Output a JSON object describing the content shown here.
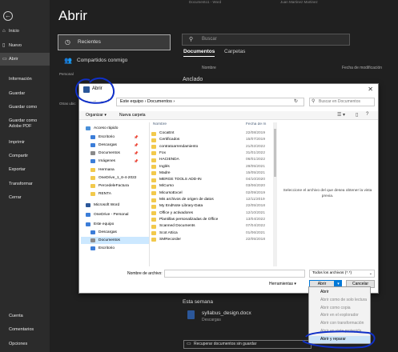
{
  "topbar": {
    "left": "Documento1  -  Word",
    "right": "Juan Martinez Martinez"
  },
  "sidebar": {
    "back": "←",
    "items": [
      {
        "label": "Inicio",
        "icon": "⌂"
      },
      {
        "label": "Nuevo",
        "icon": "▯"
      },
      {
        "label": "Abrir",
        "icon": "▭"
      }
    ],
    "plain": [
      "Información",
      "Guardar",
      "Guardar como",
      "Guardar como Adobe PDF",
      "Imprimir",
      "Compartir",
      "Exportar",
      "Transformar",
      "Cerrar"
    ],
    "bottom": [
      "Cuenta",
      "Comentarios",
      "Opciones"
    ]
  },
  "main": {
    "title": "Abrir",
    "locations": [
      {
        "label": "Recientes",
        "icon": "◷"
      },
      {
        "label": "Compartidos conmigo",
        "icon": "👥"
      }
    ],
    "personal_label": "Personal",
    "other_label": "Otras ubic",
    "search_placeholder": "Buscar",
    "tabs": [
      "Documentos",
      "Carpetas"
    ],
    "col_name": "Nombre",
    "col_date": "Fecha de modificación",
    "pinned": "Anclado",
    "this_week": "Esta semana",
    "recent_file": {
      "name": "syllabus_design.docx",
      "location": "Descargas"
    },
    "recover_button": "Recuperar documentos sin guardar"
  },
  "dialog": {
    "title": "Abrir",
    "path": "Este equipo  ›  Documentos  ›",
    "search_placeholder": "Buscar en Documentos",
    "organize": "Organizar ▾",
    "new_folder": "Nueva carpeta",
    "col_name": "Nombre",
    "col_date": "Fecha de m",
    "nav_items": [
      {
        "label": "Acceso rápido",
        "color": "#4a90d9",
        "pin": ""
      },
      {
        "label": "Escritorio",
        "color": "#3b7dd8",
        "pin": "📌"
      },
      {
        "label": "Descargas",
        "color": "#3b7dd8",
        "pin": "📌"
      },
      {
        "label": "Documentos",
        "color": "#8a8a8a",
        "pin": "📌"
      },
      {
        "label": "Imágenes",
        "color": "#3b7dd8",
        "pin": "📌"
      },
      {
        "label": "Hermana",
        "color": "#f2c94c",
        "pin": ""
      },
      {
        "label": "OneDrive_1_6-4-2022",
        "color": "#f2c94c",
        "pin": ""
      },
      {
        "label": "PercedeleFactura",
        "color": "#f2c94c",
        "pin": ""
      },
      {
        "label": "RENTA",
        "color": "#f2c94c",
        "pin": ""
      },
      {
        "label": "Microsoft Word",
        "color": "#2b579a",
        "pin": ""
      },
      {
        "label": "OneDrive - Personal",
        "color": "#3b7dd8",
        "pin": ""
      },
      {
        "label": "Este equipo",
        "color": "#3b7dd8",
        "pin": ""
      },
      {
        "label": "Descargas",
        "color": "#3b7dd8",
        "pin": ""
      },
      {
        "label": "Documentos",
        "color": "#8a8a8a",
        "pin": ""
      },
      {
        "label": "Escritorio",
        "color": "#3b7dd8",
        "pin": ""
      }
    ],
    "files": [
      {
        "name": "CocaEnt",
        "date": "22/08/2019"
      },
      {
        "name": "Certificados",
        "date": "15/07/2019"
      },
      {
        "name": "contratoarrendamiento",
        "date": "21/02/2022"
      },
      {
        "name": "Fox",
        "date": "31/01/2022"
      },
      {
        "name": "HACIENDA",
        "date": "06/01/2022"
      },
      {
        "name": "Inglés",
        "date": "28/05/2021"
      },
      {
        "name": "Madre",
        "date": "15/05/2021"
      },
      {
        "name": "MERGE TOOLS ADD-IN",
        "date": "04/10/2020"
      },
      {
        "name": "MiCurso",
        "date": "03/06/2020"
      },
      {
        "name": "MicursoExcel",
        "date": "02/09/2019"
      },
      {
        "name": "Mis archivos de origen de datos",
        "date": "12/11/2019"
      },
      {
        "name": "My EndNote Library-Data",
        "date": "22/05/2018"
      },
      {
        "name": "Office y activadores",
        "date": "12/10/2021"
      },
      {
        "name": "Plantillas personalizadas de Office",
        "date": "13/04/2022"
      },
      {
        "name": "Scanned Documents",
        "date": "07/04/2022"
      },
      {
        "name": "Scot Attica",
        "date": "01/06/2021"
      },
      {
        "name": "SMRecorder",
        "date": "22/05/2018"
      }
    ],
    "preview_text": "Seleccione el archivo del que desea obtener la vista previa.",
    "filename_label": "Nombre de archivo:",
    "filename_value": "",
    "filter": "Todos los archivos (*.*)",
    "tools": "Herramientas  ▾",
    "open_button": "Abrir",
    "cancel_button": "Cancelar",
    "menu": [
      {
        "label": "Abrir",
        "dim": false
      },
      {
        "label": "Abrir como de solo lectura",
        "dim": true
      },
      {
        "label": "Abrir como copia",
        "dim": true
      },
      {
        "label": "Abrir en el explorador",
        "dim": true
      },
      {
        "label": "Abrir con transformación",
        "dim": true
      },
      {
        "label": "Abrir en vista protegida",
        "dim": true
      },
      {
        "label": "Abrir y reparar",
        "dim": false
      }
    ]
  },
  "annotation_color": "#1030c8"
}
